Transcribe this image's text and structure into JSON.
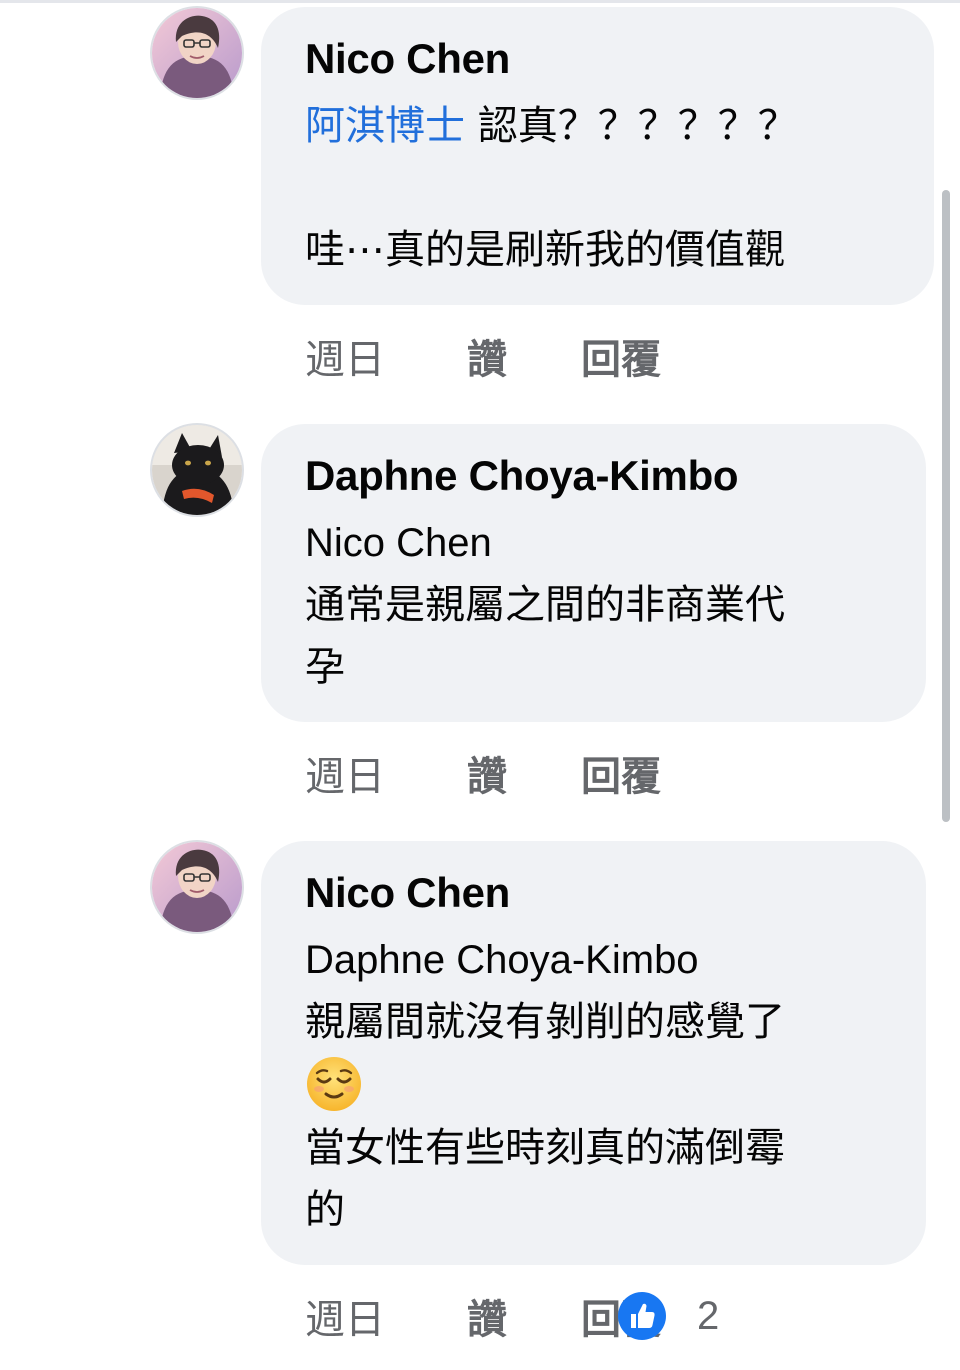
{
  "colors": {
    "bubble": "#f0f2f5",
    "mention": "#216fdb",
    "meta_text": "#65676b",
    "like_blue": "#1877f2"
  },
  "comments": [
    {
      "author": "Nico Chen",
      "mention": "阿淇博士",
      "line1_rest": " 認真？？？？？？",
      "line2": "哇⋯真的是刷新我的價值觀",
      "time": "週日",
      "like": "讚",
      "reply": "回覆"
    },
    {
      "author": "Daphne Choya-Kimbo",
      "mention": "Nico Chen",
      "line1": "通常是親屬之間的非商業代",
      "line2": "孕",
      "time": "週日",
      "like": "讚",
      "reply": "回覆"
    },
    {
      "author": "Nico Chen",
      "mention": "Daphne Choya-Kimbo",
      "line1": "親屬間就沒有剝削的感覺了",
      "emoji_icon": "relieved-face-emoji",
      "line3": "當女性有些時刻真的滿倒霉",
      "line4": "的",
      "time": "週日",
      "like": "讚",
      "reply": "回覆",
      "reaction_icon": "like-thumb-icon",
      "reaction_count": "2"
    }
  ]
}
